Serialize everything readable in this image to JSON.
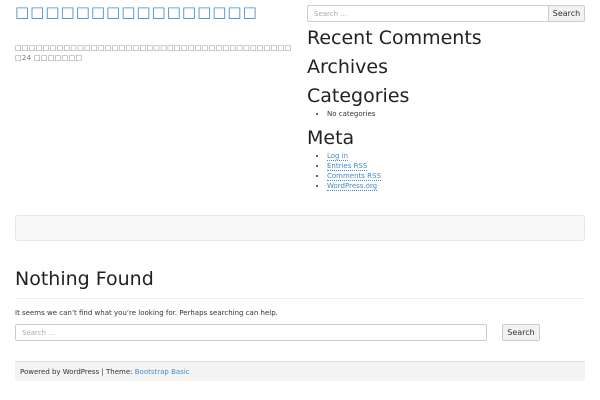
{
  "site": {
    "title": "□□□□□□□□□□□□□□□□",
    "description": "□□□□□□□□□□□□□□□□□□□□□□□□□□□□□□□□□□□□□□□□□24 □□□□□□□"
  },
  "sidebar": {
    "search": {
      "placeholder": "Search …",
      "button": "Search"
    },
    "recent_comments": "Recent Comments",
    "archives": "Archives",
    "categories": {
      "title": "Categories",
      "items": [
        "No categories"
      ]
    },
    "meta": {
      "title": "Meta",
      "links": [
        "Log in",
        "Entries RSS",
        "Comments RSS",
        "WordPress.org"
      ]
    }
  },
  "main": {
    "title": "Nothing Found",
    "message": "It seems we can’t find what you’re looking for. Perhaps searching can help.",
    "search": {
      "placeholder": "Search …",
      "button": "Search"
    }
  },
  "footer": {
    "powered": "Powered by WordPress | Theme: ",
    "theme_link": "Bootstrap Basic"
  }
}
